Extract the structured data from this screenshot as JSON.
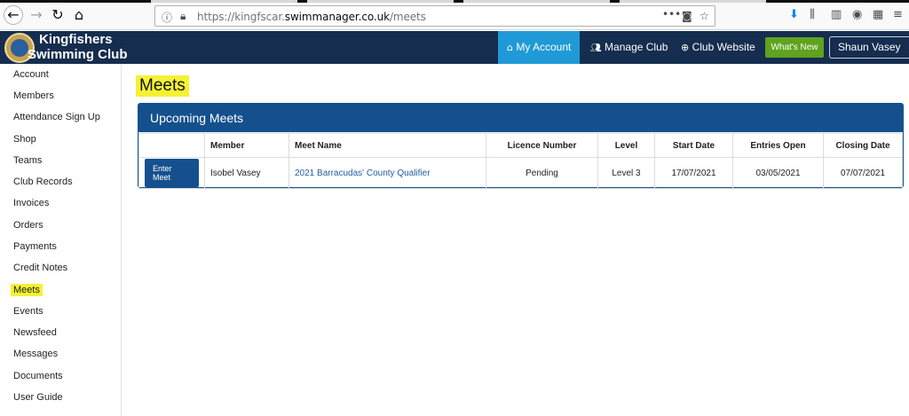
{
  "browser": {
    "url_prefix": "https://kingfscar.",
    "url_domain": "swimmanager.co.uk",
    "url_path": "/meets"
  },
  "header": {
    "club_line1": "Kingfishers",
    "club_line2": "Swimming Club",
    "nav": [
      {
        "label": "My Account",
        "icon": "home-icon",
        "active": true
      },
      {
        "label": "Manage Club",
        "icon": "users-icon"
      },
      {
        "label": "Club Website",
        "icon": "globe-icon"
      }
    ],
    "whats_new": "What's New",
    "user": "Shaun Vasey"
  },
  "sidebar": {
    "items": [
      "Account",
      "Members",
      "Attendance Sign Up",
      "Shop",
      "Teams",
      "Club Records",
      "Invoices",
      "Orders",
      "Payments",
      "Credit Notes",
      "Meets",
      "Events",
      "Newsfeed",
      "Messages",
      "Documents",
      "User Guide"
    ],
    "active": "Meets"
  },
  "main": {
    "title": "Meets",
    "panel_title": "Upcoming Meets",
    "columns": [
      "",
      "Member",
      "Meet Name",
      "Licence Number",
      "Level",
      "Start Date",
      "Entries Open",
      "Closing Date"
    ],
    "rows": [
      {
        "action": "Enter Meet",
        "member": "Isobel Vasey",
        "meet_name": "2021 Barracudas' County Qualifier",
        "licence": "Pending",
        "level": "Level 3",
        "start_date": "17/07/2021",
        "entries_open": "03/05/2021",
        "closing_date": "07/07/2021"
      }
    ]
  },
  "colors": {
    "header_bg": "#152d4f",
    "active_nav": "#1f9ad6",
    "panel_blue": "#15508e",
    "whats_new_green": "#5fa31f",
    "highlight": "#f4f233"
  }
}
